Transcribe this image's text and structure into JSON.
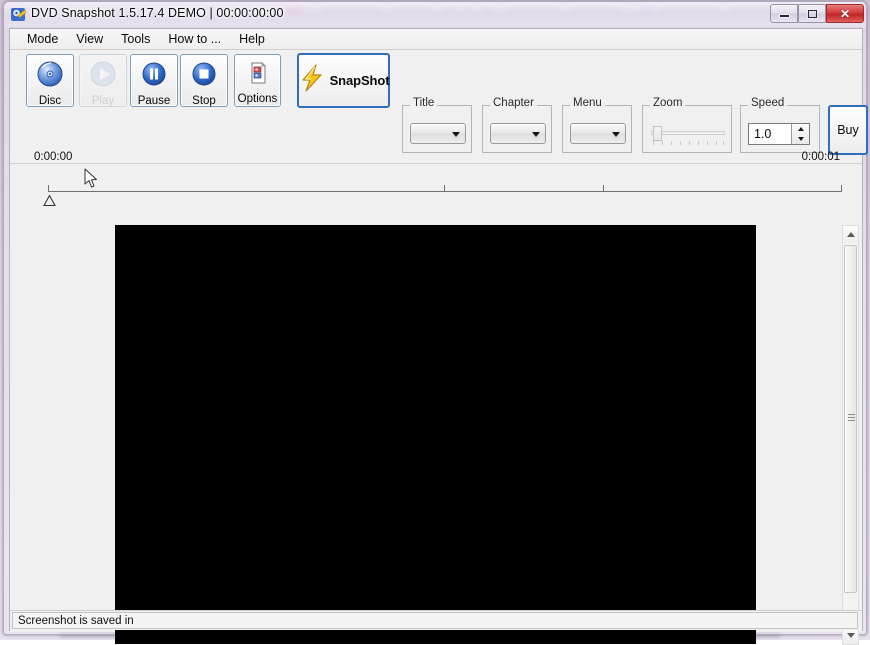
{
  "window": {
    "title": "DVD Snapshot 1.5.17.4 DEMO  | 00:00:00:00",
    "app_icon": "dvd-snapshot-icon",
    "controls": {
      "minimize_label": "Minimize",
      "maximize_label": "Restore",
      "close_label": "✕"
    }
  },
  "menubar": {
    "items": [
      {
        "label": "Mode",
        "name": "menu-mode"
      },
      {
        "label": "View",
        "name": "menu-view"
      },
      {
        "label": "Tools",
        "name": "menu-tools"
      },
      {
        "label": "How to ...",
        "name": "menu-how-to"
      },
      {
        "label": "Help",
        "name": "menu-help"
      }
    ]
  },
  "toolbar": {
    "disc_label": "Disc",
    "play_label": "Play",
    "pause_label": "Pause",
    "stop_label": "Stop",
    "options_label": "Options",
    "snapshot_label": "SnapShot",
    "buy_label": "Buy",
    "play_enabled": false,
    "icons": {
      "disc": "cd-disc-icon",
      "play": "play-circle-icon",
      "pause": "pause-circle-icon",
      "stop": "stop-circle-icon",
      "options": "options-document-icon",
      "snapshot": "lightning-bolt-icon"
    }
  },
  "selectors": {
    "title": {
      "label": "Title",
      "value": ""
    },
    "chapter": {
      "label": "Chapter",
      "value": ""
    },
    "menu": {
      "label": "Menu",
      "value": ""
    }
  },
  "zoom_control": {
    "label": "Zoom",
    "value": 0,
    "enabled": false,
    "ticks": 9
  },
  "speed_control": {
    "label": "Speed",
    "value": "1.0"
  },
  "timeline": {
    "start_label": "0:00:00",
    "end_label": "0:00:01",
    "position": 0,
    "ticks": [
      0.5,
      0.8,
      1.0
    ]
  },
  "video": {
    "background_color": "#000000"
  },
  "scrollbar": {
    "up_arrow": "scroll-up-arrow-icon",
    "down_arrow": "scroll-down-arrow-icon"
  },
  "statusbar": {
    "text": "Screenshot is saved in"
  },
  "colors": {
    "accent_blue": "#2f6fbd",
    "icon_blue": "#2b5fb8",
    "bolt_yellow": "#f5c518",
    "close_red": "#d33b3b",
    "window_bg": "#f0f0f0"
  }
}
